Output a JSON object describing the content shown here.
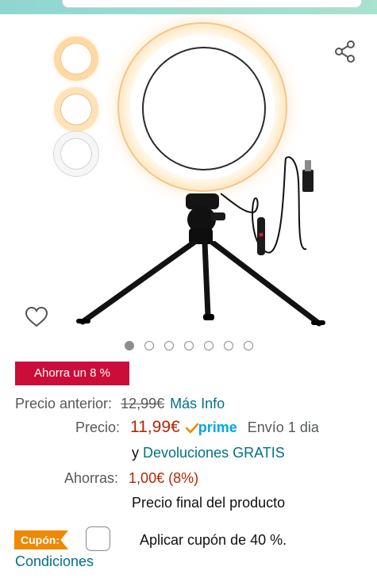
{
  "colors": {
    "deal_badge": "#cc0c39",
    "price_red": "#b12704",
    "link_teal": "#007185",
    "prime_blue": "#00a8e1",
    "coupon_orange": "#f08804"
  },
  "icons": {
    "share": "share-icon",
    "wishlist": "heart-outline-icon",
    "prime": "prime-check-icon"
  },
  "gallery": {
    "thumbnail_count": 3,
    "dot_count": 7,
    "active_dot": 1
  },
  "deal": {
    "badge": "Ahorra un 8 %"
  },
  "pricing": {
    "previous_label": "Precio anterior:",
    "previous_value": "12,99€",
    "more_info": "Más Info",
    "price_label": "Precio:",
    "price_value": "11,99€",
    "prime": "prime",
    "shipping": "Envío 1 dia",
    "returns_prefix": "y",
    "returns_link": "Devoluciones GRATIS",
    "savings_label": "Ahorras:",
    "savings_value": "1,00€ (8%)",
    "final_note": "Precio final del producto"
  },
  "coupon": {
    "tag": "Cupón:",
    "text": "Aplicar cupón de 40 %.",
    "conditions": "Condiciones"
  }
}
